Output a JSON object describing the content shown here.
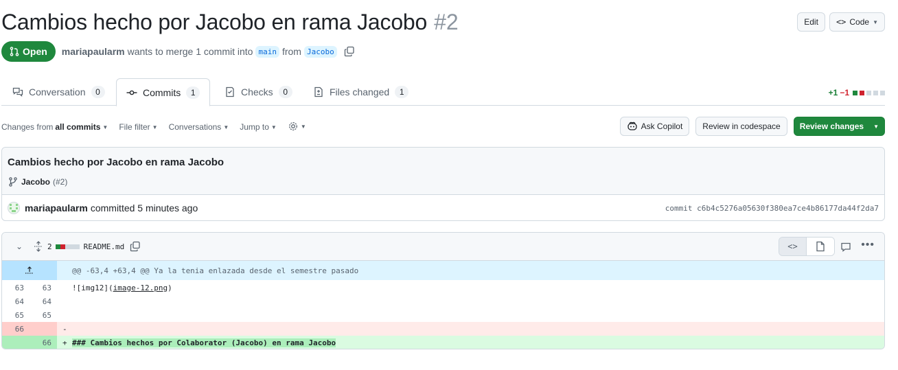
{
  "pr": {
    "title": "Cambios hecho por Jacobo en rama Jacobo",
    "number": "#2",
    "state": "Open",
    "author": "mariapaularm",
    "merge_text_pre": "wants to merge 1 commit into",
    "base_branch": "main",
    "from_text": "from",
    "head_branch": "Jacobo"
  },
  "header_actions": {
    "edit": "Edit",
    "code": "Code"
  },
  "tabs": [
    {
      "label": "Conversation",
      "count": "0"
    },
    {
      "label": "Commits",
      "count": "1"
    },
    {
      "label": "Checks",
      "count": "0"
    },
    {
      "label": "Files changed",
      "count": "1"
    }
  ],
  "diffstat": {
    "additions": "+1",
    "deletions": "−1"
  },
  "toolbar": {
    "changes_from_prefix": "Changes from",
    "changes_from_value": "all commits",
    "file_filter": "File filter",
    "conversations": "Conversations",
    "jump_to": "Jump to",
    "ask_copilot": "Ask Copilot",
    "review_codespace": "Review in codespace",
    "review_changes": "Review changes"
  },
  "commit": {
    "title": "Cambios hecho por Jacobo en rama Jacobo",
    "branch": "Jacobo",
    "ref": "(#2)",
    "author": "mariapaularm",
    "action": "committed 5 minutes ago",
    "sha_text": "commit c6b4c5276a05630f380ea7ce4b86177da44f2da7"
  },
  "file": {
    "changes_count": "2",
    "name": "README.md",
    "hunk_header": "@@ -63,4 +63,4 @@ Ya la tenia enlazada desde el semestre pasado",
    "lines": [
      {
        "old": "63",
        "new": "63",
        "type": "ctx",
        "marker": "",
        "text": "![img12](",
        "link": "image-12.png",
        "after": ")"
      },
      {
        "old": "64",
        "new": "64",
        "type": "ctx",
        "marker": "",
        "text": "",
        "link": "",
        "after": ""
      },
      {
        "old": "65",
        "new": "65",
        "type": "ctx",
        "marker": "",
        "text": "",
        "link": "",
        "after": ""
      },
      {
        "old": "66",
        "new": "",
        "type": "del",
        "marker": "-",
        "text": "",
        "link": "",
        "after": ""
      },
      {
        "old": "",
        "new": "66",
        "type": "add",
        "marker": "+",
        "text": "### Cambios hechos por Colaborator (Jacobo) en rama Jacobo",
        "link": "",
        "after": ""
      }
    ]
  },
  "icons": [
    "git-pull-request-icon",
    "copy-icon",
    "comment-discussion-icon",
    "git-commit-icon",
    "checklist-icon",
    "file-diff-icon",
    "gear-icon",
    "copilot-icon",
    "git-branch-icon",
    "chevron-down-icon",
    "unfold-icon",
    "code-icon",
    "file-icon",
    "comment-icon",
    "kebab-icon",
    "fold-up-icon"
  ]
}
